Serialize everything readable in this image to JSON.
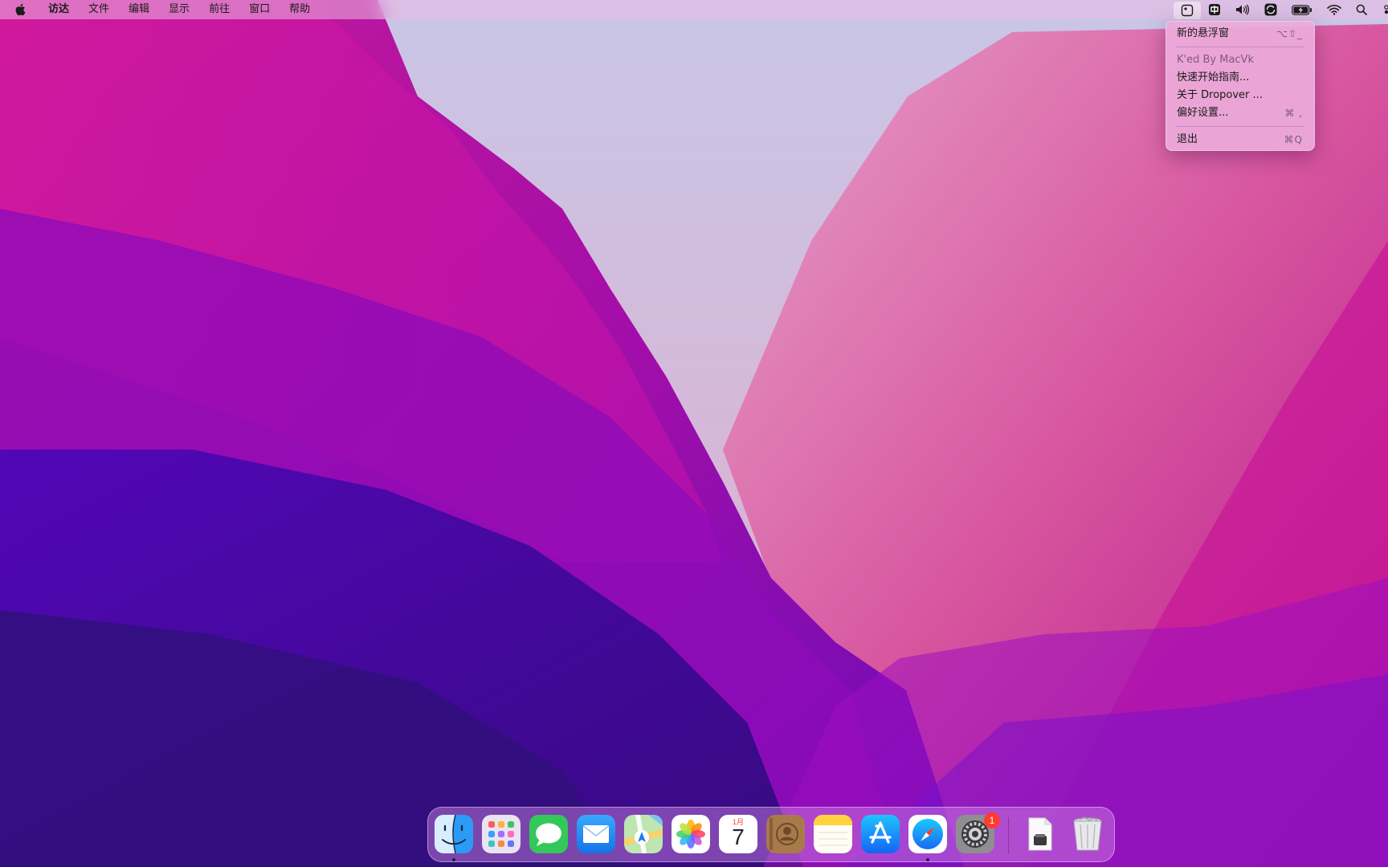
{
  "menubar": {
    "items": [
      {
        "label": "访达",
        "bold": true
      },
      {
        "label": "文件"
      },
      {
        "label": "编辑"
      },
      {
        "label": "显示"
      },
      {
        "label": "前往"
      },
      {
        "label": "窗口"
      },
      {
        "label": "帮助"
      }
    ],
    "status_icons": [
      "dropover-icon",
      "input-method-icon",
      "volume-icon",
      "sync-icon",
      "battery-charging-icon",
      "wifi-icon",
      "spotlight-search-icon",
      "control-center-icon"
    ]
  },
  "dropdown": {
    "items": [
      {
        "label": "新的悬浮窗",
        "shortcut": "⌥⇧_"
      },
      {
        "label": "K'ed By MacVk",
        "disabled": true
      },
      {
        "label": "快速开始指南..."
      },
      {
        "label": "关于 Dropover ..."
      },
      {
        "label": "偏好设置...",
        "shortcut": "⌘ ,"
      },
      {
        "label": "退出",
        "shortcut": "⌘Q"
      }
    ]
  },
  "dock": {
    "apps": [
      "finder",
      "launchpad",
      "messages",
      "mail",
      "maps",
      "photos",
      "calendar",
      "contacts",
      "notes",
      "app-store",
      "safari",
      "system-preferences",
      "document",
      "trash"
    ],
    "calendar": {
      "month": "1月",
      "day": "7"
    },
    "system_preferences_badge": "1"
  },
  "colors": {
    "menubar": "#ebb9e1",
    "dropdown": "#ecaada",
    "badge": "#ff3b30",
    "wallpaper_magenta": "#c218a8",
    "wallpaper_violet": "#4a06b8"
  }
}
